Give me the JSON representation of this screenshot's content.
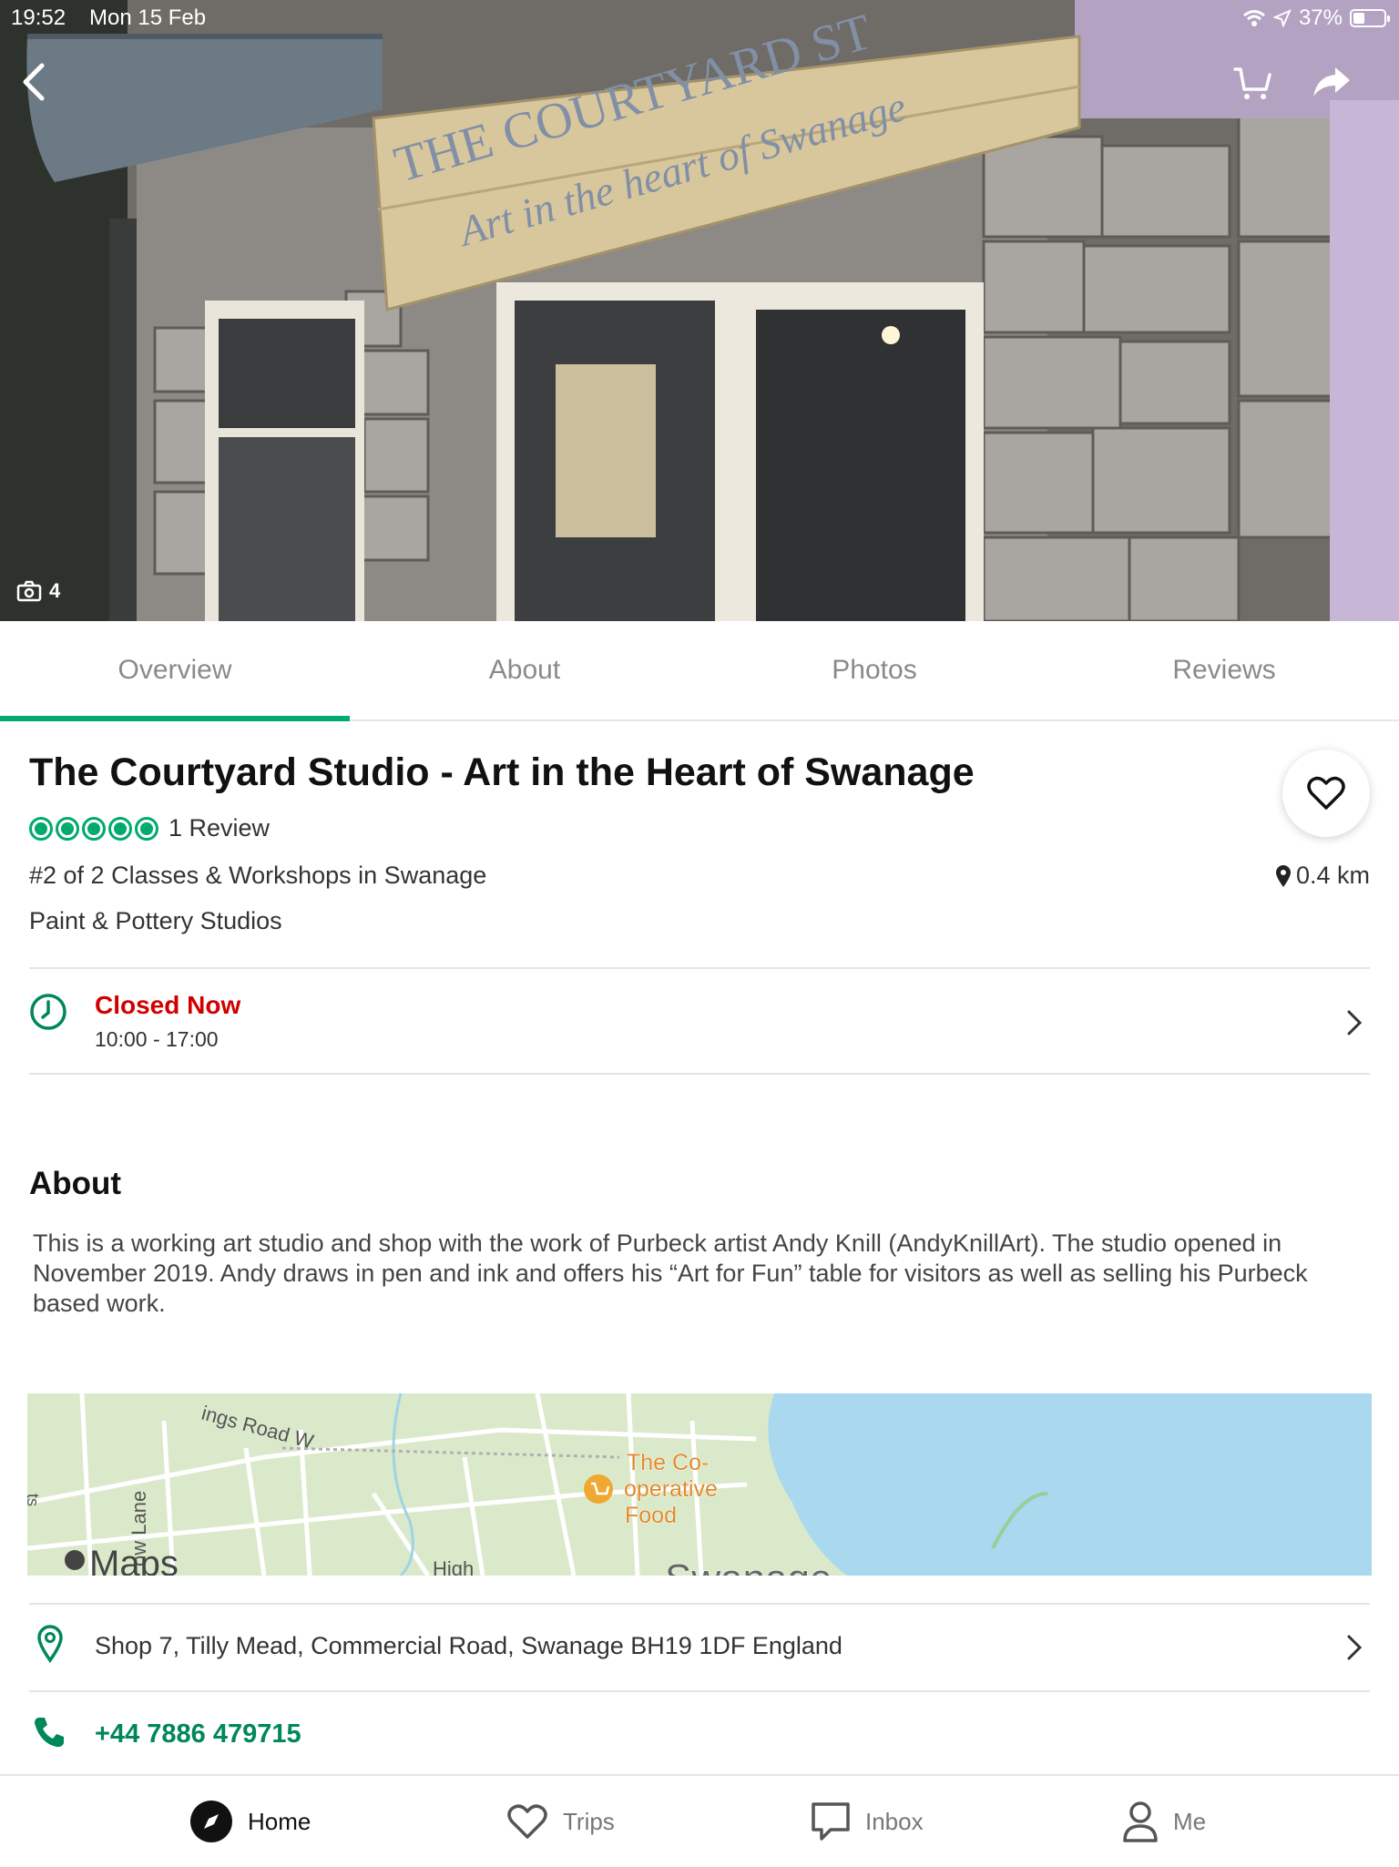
{
  "status_bar": {
    "time": "19:52",
    "date": "Mon 15 Feb",
    "battery": "37%",
    "battery_level": 0.37
  },
  "hero": {
    "sign_line1": "THE COURTYARD ST",
    "sign_line2": "Art in the heart of Swanage",
    "photo_count": "4",
    "icons": [
      "back-icon",
      "cart-icon",
      "share-icon",
      "camera-icon"
    ]
  },
  "tabs": [
    {
      "label": "Overview",
      "active": true
    },
    {
      "label": "About"
    },
    {
      "label": "Photos"
    },
    {
      "label": "Reviews"
    }
  ],
  "listing": {
    "title": "The Courtyard Studio - Art in the Heart of Swanage",
    "rating": 5,
    "review_count": "1 Review",
    "rank": "#2 of 2 Classes & Workshops in Swanage",
    "distance": "0.4 km",
    "subcategory": "Paint & Pottery Studios"
  },
  "hours": {
    "status": "Closed Now",
    "range": "10:00 - 17:00"
  },
  "about": {
    "heading": "About",
    "text": "This is a working art studio and shop with the work of Purbeck artist Andy Knill (AndyKnillArt). The studio opened in November 2019. Andy draws in pen and ink and offers his “Art for Fun” table for visitors as well as selling his Purbeck based work."
  },
  "map": {
    "road1": "ings Road W",
    "road2": "ow Lane",
    "road3": "High",
    "poi": [
      "The Co-",
      "operative",
      "Food"
    ],
    "town": "Swanage",
    "maps_logo": "Maps",
    "edge_label": "ts"
  },
  "contact": {
    "address": "Shop 7, Tilly Mead, Commercial Road, Swanage BH19 1DF England",
    "phone": "+44 7886 479715"
  },
  "colors": {
    "accent": "#00aa6c",
    "closed": "#d10000",
    "phone": "#00875a"
  },
  "bottom_nav": [
    {
      "label": "Home",
      "icon": "compass-icon",
      "active": true
    },
    {
      "label": "Trips",
      "icon": "heart-icon"
    },
    {
      "label": "Inbox",
      "icon": "inbox-icon"
    },
    {
      "label": "Me",
      "icon": "person-icon"
    }
  ]
}
